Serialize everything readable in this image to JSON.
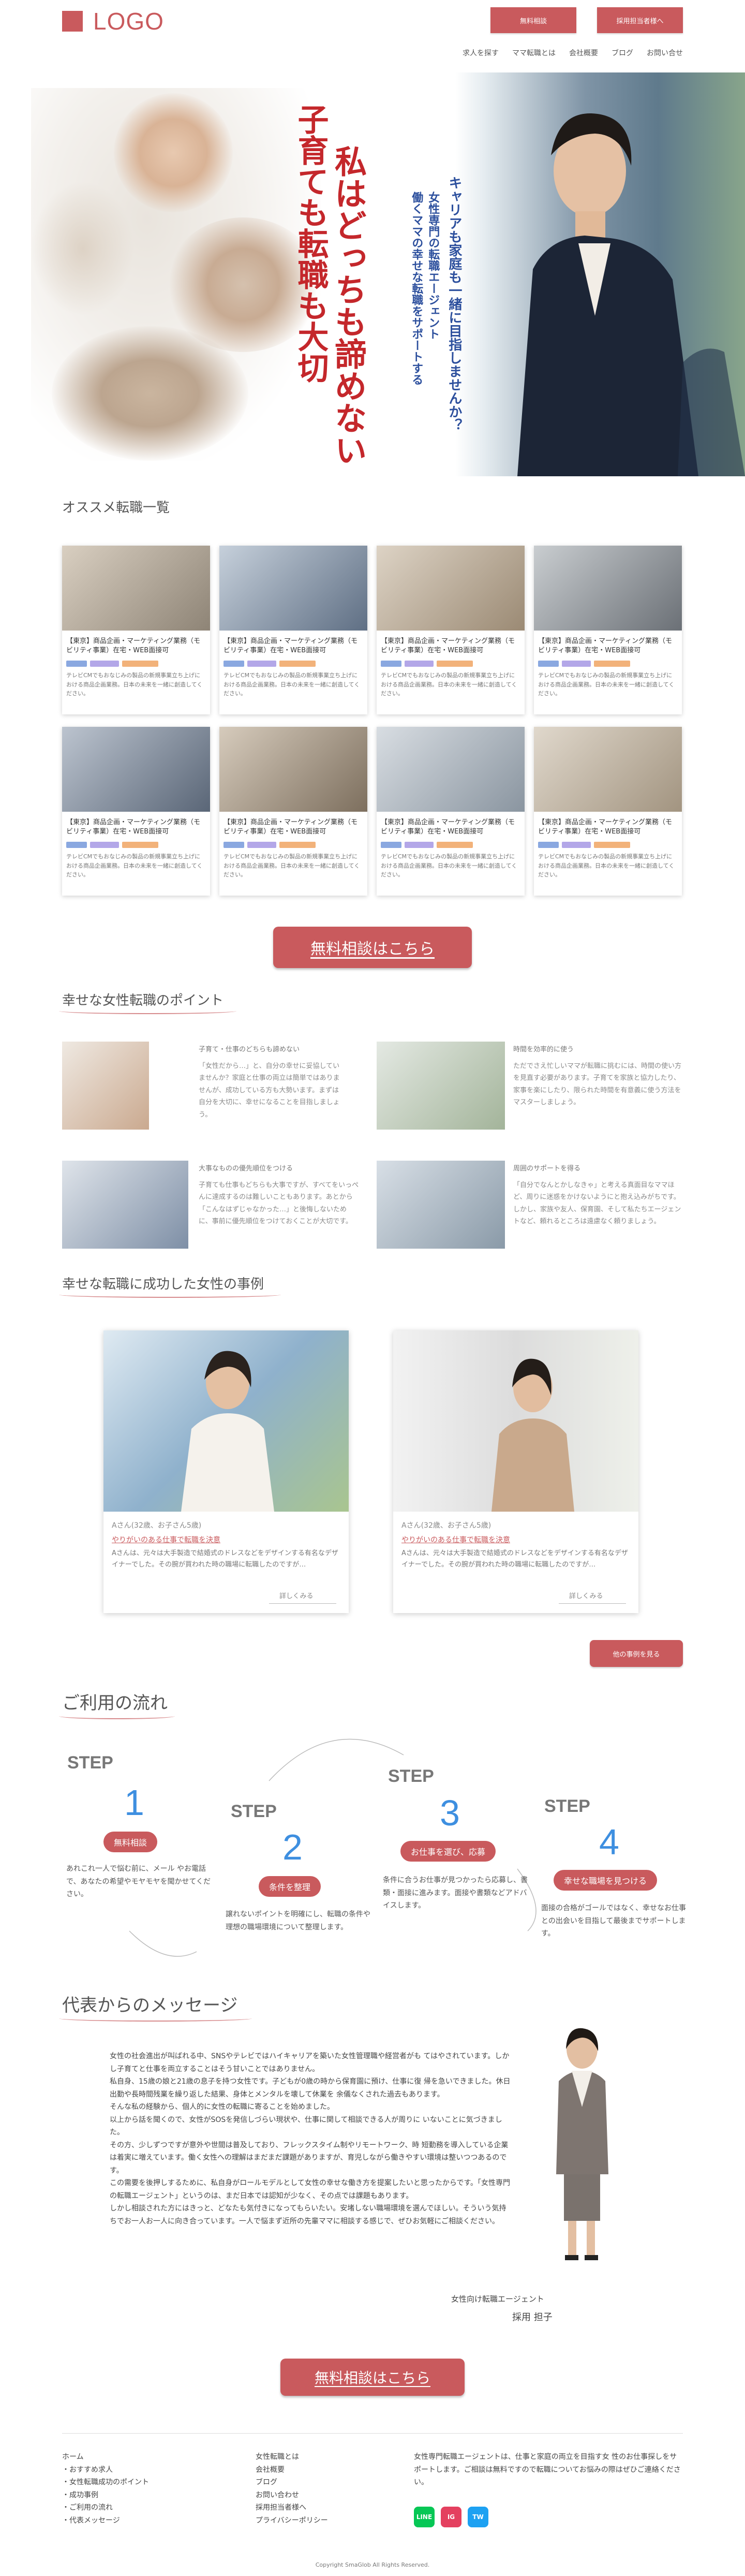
{
  "header": {
    "logo": "LOGO",
    "btn_consult": "無料相談",
    "btn_recruit": "採用担当者様へ",
    "nav": [
      "求人を探す",
      "ママ転職とは",
      "会社概要",
      "ブログ",
      "お問い合せ"
    ]
  },
  "hero": {
    "catch_red1": "子育ても転職も大切",
    "catch_red2": "私はどっちも諦めない",
    "catch_blue1": "キャリアも家庭も一緒に目指しませんか？",
    "catch_blue2": "女性専門の転職エージェント",
    "catch_blue3": "働くママの幸せな転職をサポートする"
  },
  "jobs_section": {
    "title": "オススメ転職一覧",
    "items": [
      {
        "title": "【東京】商品企画・マーケティング業務（モビリティ事業）在宅・WEB面接可",
        "desc": "テレビCMでもおなじみの製品の新規事業立ち上げにおける商品企画業務。日本の未来を一緒に創造してください。"
      },
      {
        "title": "【東京】商品企画・マーケティング業務（モビリティ事業）在宅・WEB面接可",
        "desc": "テレビCMでもおなじみの製品の新規事業立ち上げにおける商品企画業務。日本の未来を一緒に創造してください。"
      },
      {
        "title": "【東京】商品企画・マーケティング業務（モビリティ事業）在宅・WEB面接可",
        "desc": "テレビCMでもおなじみの製品の新規事業立ち上げにおける商品企画業務。日本の未来を一緒に創造してください。"
      },
      {
        "title": "【東京】商品企画・マーケティング業務（モビリティ事業）在宅・WEB面接可",
        "desc": "テレビCMでもおなじみの製品の新規事業立ち上げにおける商品企画業務。日本の未来を一緒に創造してください。"
      },
      {
        "title": "【東京】商品企画・マーケティング業務（モビリティ事業）在宅・WEB面接可",
        "desc": "テレビCMでもおなじみの製品の新規事業立ち上げにおける商品企画業務。日本の未来を一緒に創造してください。"
      },
      {
        "title": "【東京】商品企画・マーケティング業務（モビリティ事業）在宅・WEB面接可",
        "desc": "テレビCMでもおなじみの製品の新規事業立ち上げにおける商品企画業務。日本の未来を一緒に創造してください。"
      },
      {
        "title": "【東京】商品企画・マーケティング業務（モビリティ事業）在宅・WEB面接可",
        "desc": "テレビCMでもおなじみの製品の新規事業立ち上げにおける商品企画業務。日本の未来を一緒に創造してください。"
      },
      {
        "title": "【東京】商品企画・マーケティング業務（モビリティ事業）在宅・WEB面接可",
        "desc": "テレビCMでもおなじみの製品の新規事業立ち上げにおける商品企画業務。日本の未来を一緒に創造してください。"
      }
    ],
    "tag_colors": [
      "#8aa8e0",
      "#b3a7e8",
      "#f2b27a"
    ]
  },
  "cta": {
    "label": "無料相談はこちら"
  },
  "points": {
    "title": "幸せな女性転職のポイント",
    "items": [
      {
        "heading": "子育て・仕事のどちらも諦めない",
        "text": "「女性だから…」と、自分の幸せに妥協していませんか？家庭と仕事の両立は簡単ではありませんが、成功している方も大勢います。まずは自分を大切に、幸せになることを目指しましょう。"
      },
      {
        "heading": "時間を効率的に使う",
        "text": "ただでさえ忙しいママが転職に挑むには、時間の使い方を見直す必要があります。子育てを家族と協力したり、家事を楽にしたり、限られた時間を有意義に使う方法をマスターしましょう。"
      },
      {
        "heading": "大事なものの優先順位をつける",
        "text": "子育ても仕事もどちらも大事ですが、すべてをいっぺんに達成するのは難しいこともあります。あとから「こんなはずじゃなかった…」と後悔しないために、事前に優先順位をつけておくことが大切です。"
      },
      {
        "heading": "周囲のサポートを得る",
        "text": "「自分でなんとかしなきゃ」と考える真面目なママほど、周りに迷惑をかけないようにと抱え込みがちです。しかし、家族や友人、保育園、そして私たちエージェントなど、頼れるところは遠慮なく頼りましょう。"
      }
    ]
  },
  "cases": {
    "title": "幸せな転職に成功した女性の事例",
    "items": [
      {
        "name": "Aさん(32歳、お子さん5歳)",
        "title": "やりがいのある仕事で転職を決意",
        "text": "Aさんは、元々は大手製造で結婚式のドレスなどをデザインする有名なデザイナーでした。その腕が買われた時の職場に転職したのですが…",
        "more": "詳しくみる"
      },
      {
        "name": "Aさん(32歳、お子さん5歳)",
        "title": "やりがいのある仕事で転職を決意",
        "text": "Aさんは、元々は大手製造で結婚式のドレスなどをデザインする有名なデザイナーでした。その腕が買われた時の職場に転職したのですが…",
        "more": "詳しくみる"
      }
    ],
    "more_btn": "他の事例を見る"
  },
  "flow": {
    "title": "ご利用の流れ",
    "steps": [
      {
        "word": "STEP",
        "num": "1",
        "badge": "無料相談",
        "text": "あれこれ一人で悩む前に、メール やお電話で、あなたの希望やモヤモヤを聞かせてください。"
      },
      {
        "word": "STEP",
        "num": "2",
        "badge": "条件を整理",
        "text": "譲れないポイントを明確にし、転職の条件や理想の職場環境について整理します。"
      },
      {
        "word": "STEP",
        "num": "3",
        "badge": "お仕事を選び、応募",
        "text": "条件に合うお仕事が見つかったら応募し、書類・面接に進みます。面接や書類などアドバイスします。"
      },
      {
        "word": "STEP",
        "num": "4",
        "badge": "幸せな職場を見つける",
        "text": "面接の合格がゴールではなく、幸せなお仕事との出会いを目指して最後までサポートします。"
      }
    ]
  },
  "message": {
    "title": "代表からのメッセージ",
    "body": "女性の社会進出が叫ばれる中、SNSやテレビではハイキャリアを築いた女性管理職や経営者がも てはやされています。しかし子育てと仕事を両立することはそう甘いことではありません。\n私自身、15歳の娘と21歳の息子を持つ女性です。子どもが0歳の時から保育園に預け、仕事に復 帰を急いできました。休日出勤や長時間残業を繰り返した結果、身体とメンタルを壊して休業を 余儀なくされた過去もあります。\nそんな私の経験から、個人的に女性の転職に寄ることを始めました。\n以上から話を聞くので、女性がSOSを発信しづらい現状や、仕事に関して相談できる人が周りに いないことに気づきました。\nその方、少しずつですが意外や世間は普及しており、フレックスタイム制やリモートワーク、時 短勤務を導入している企業は着実に増えています。働く女性への理解はまだまだ課題がありますが、育児しながら働きやすい環境は整いつつあるのです。\nこの需要を後押しするために、私自身がロールモデルとして女性の幸せな働き方を提案したいと思ったからです。「女性専門の転職エージェント」というのは、まだ日本では認知が少なく、その点では課題もあります。\nしかし相談された方にはきっと、どなたも気付きになってもらいたい。安堵しない職場環境を選んでほしい。そういう気持ちでお一人お一人に向き合っています。一人で悩まず近所の先輩ママに相談する感じで、ぜひお気軽にご相談ください。",
    "sign_role": "女性向け転職エージェント",
    "sign_name": "採用 担子"
  },
  "footer": {
    "col1": [
      "ホーム",
      "・おすすめ求人",
      "・女性転職成功のポイント",
      "・成功事例",
      "・ご利用の流れ",
      "・代表メッセージ"
    ],
    "col2": [
      "女性転職とは",
      "会社概要",
      "ブログ",
      "お問い合わせ",
      "採用担当者様へ",
      "プライバシーポリシー"
    ],
    "about": "女性専門転職エージェントは、仕事と家庭の両立を目指す女 性のお仕事探しをサポートします。ご相談は無料ですので転職についてお悩みの際はぜひご連絡ください。",
    "sns": [
      {
        "icon": "line-icon",
        "color": "#06c755",
        "label": "LINE"
      },
      {
        "icon": "instagram-icon",
        "color": "#e4405f",
        "label": "IG"
      },
      {
        "icon": "twitter-icon",
        "color": "#1da1f2",
        "label": "TW"
      }
    ],
    "copyright": "Copyright SmaGlob All Rights Reserved."
  }
}
